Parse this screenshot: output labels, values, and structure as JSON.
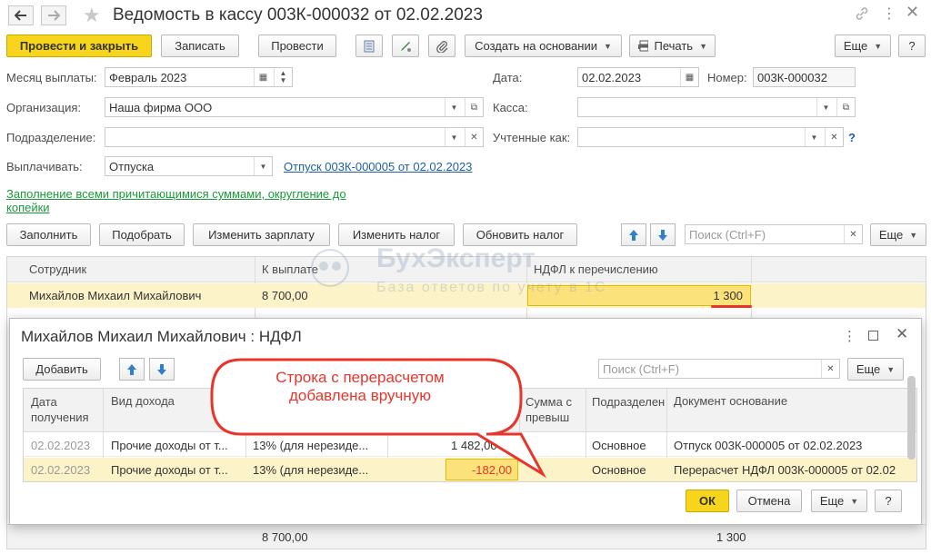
{
  "window": {
    "title": "Ведомость в кассу 003К-000032 от 02.02.2023"
  },
  "toolbar": {
    "post_close": "Провести и закрыть",
    "save": "Записать",
    "post": "Провести",
    "create_based_on": "Создать на основании",
    "print": "Печать",
    "more": "Еще",
    "help": "?"
  },
  "form": {
    "month_label": "Месяц выплаты:",
    "month_value": "Февраль 2023",
    "date_label": "Дата:",
    "date_value": "02.02.2023",
    "number_label": "Номер:",
    "number_value": "003К-000032",
    "org_label": "Организация:",
    "org_value": "Наша фирма ООО",
    "cash_label": "Касса:",
    "cash_value": "",
    "dept_label": "Подразделение:",
    "dept_value": "",
    "counted_label": "Учтенные как:",
    "counted_value": "",
    "counted_help": "?",
    "pay_label": "Выплачивать:",
    "pay_value": "Отпуска",
    "pay_doc_link": "Отпуск 003К-000005 от 02.02.2023",
    "fill_link": "Заполнение всеми причитающимися суммами, округление до копейки"
  },
  "table_toolbar": {
    "fill": "Заполнить",
    "select": "Подобрать",
    "change_salary": "Изменить зарплату",
    "change_tax": "Изменить налог",
    "update_tax": "Обновить налог",
    "search_placeholder": "Поиск (Ctrl+F)",
    "more": "Еще"
  },
  "main_table": {
    "columns": [
      "Сотрудник",
      "К выплате",
      "НДФЛ к перечислению"
    ],
    "rows": [
      {
        "employee": "Михайлов Михаил Михайлович",
        "amount": "8 700,00",
        "tax": "1 300"
      }
    ],
    "totals": {
      "amount": "8 700,00",
      "tax": "1 300"
    }
  },
  "watermark": {
    "brand": "БухЭксперт",
    "tagline": "База ответов по учету в 1С"
  },
  "dialog": {
    "title": "Михайлов Михаил Михайлович : НДФЛ",
    "add": "Добавить",
    "search_placeholder": "Поиск (Ctrl+F)",
    "more": "Еще",
    "columns": [
      "Дата получения",
      "Вид дохода",
      "",
      "",
      "Сумма с превыш",
      "Подразделение",
      "Документ основание"
    ],
    "rows": [
      {
        "date": "02.02.2023",
        "income": "Прочие доходы от т...",
        "rate": "13% (для нерезиде...",
        "amount": "1 482,00",
        "dept": "Основное",
        "doc": "Отпуск 003К-000005 от 02.02.2023"
      },
      {
        "date": "02.02.2023",
        "income": "Прочие доходы от т...",
        "rate": "13% (для нерезиде...",
        "amount": "-182,00",
        "dept": "Основное",
        "doc": "Перерасчет НДФЛ 003К-000005 от 02.02"
      }
    ],
    "ok": "ОК",
    "cancel": "Отмена",
    "help": "?"
  },
  "callout": {
    "text": "Строка с перерасчетом добавлена вручную"
  },
  "colors": {
    "accent_yellow": "#f7d51c",
    "selected_row": "#fdf3c9",
    "callout_red": "#e8352c",
    "link_blue": "#1f5fa8",
    "link_green": "#1a9a3a"
  }
}
